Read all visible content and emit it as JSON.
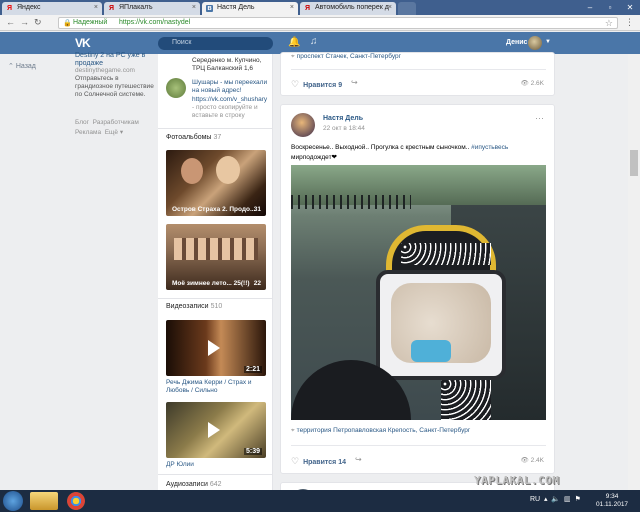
{
  "browser": {
    "tabs": [
      {
        "label": "Яндекс",
        "icon": "yandex-icon"
      },
      {
        "label": "ЯПлакалъ",
        "icon": "yaplakal-icon"
      },
      {
        "label": "Настя Дель",
        "icon": "vk-icon",
        "active": true
      },
      {
        "label": "Автомобиль поперек д",
        "icon": "yaplakal-icon"
      }
    ],
    "secure_label": "Надежный",
    "url": "https://vk.com/nastydel"
  },
  "vk": {
    "logo": "VK",
    "search_placeholder": "Поиск",
    "user_name": "Денис"
  },
  "left": {
    "back": "Назад",
    "ad_title": "Destiny 2 на PC уже в продаже",
    "ad_domain": "destinythegame.com",
    "ad_text": "Отправьтесь в грандиозное путешествие по Солнечной системе.",
    "footer": [
      "Блог",
      "Разработчикам",
      "Реклама",
      "Ещё"
    ]
  },
  "middle": {
    "top_text": "Середенко м. Купчино, ТРЦ Балканский 1,6",
    "shusha_title": "Шушары - мы переехали на новый адрес!",
    "shusha_url": "https://vk.com/v_shushary",
    "shusha_tail": "- просто скопируйте и вставьте в строку",
    "albums_label": "Фотоальбомы",
    "albums_count": "37",
    "albums": [
      {
        "caption": "Остров Страха 2. Продо...",
        "count": "31"
      },
      {
        "caption": "Моё зимнее лето... 25(!!)",
        "count": "22"
      }
    ],
    "videos_label": "Видеозаписи",
    "videos_count": "510",
    "videos": [
      {
        "duration": "2:21",
        "caption": "Речь Джима Керри / Страх и Любовь / Сильно"
      },
      {
        "duration": "5:39",
        "caption": "ДР Юлии"
      }
    ],
    "audio_label": "Аудиозаписи",
    "audio_count": "642"
  },
  "feed": {
    "post0": {
      "location": "проспект Стачек, Санкт-Петербург",
      "likes_label": "Нравится",
      "likes": "9",
      "views": "2.6K"
    },
    "post1": {
      "author": "Настя Дель",
      "date": "22 окт в 18:44",
      "text": "Воскресенье.. Выходной.. Прогулка с крестным сыночком..",
      "hashtag": "#ипустьвесь",
      "text2": "мирподождет❤",
      "location": "территория Петропавловская Крепость, Санкт-Петербург",
      "likes_label": "Нравится",
      "likes": "14",
      "views": "2.4K"
    }
  },
  "taskbar": {
    "lang": "RU",
    "time": "9:34",
    "date": "01.11.2017"
  },
  "watermark": "YAPLAKAL.COM"
}
